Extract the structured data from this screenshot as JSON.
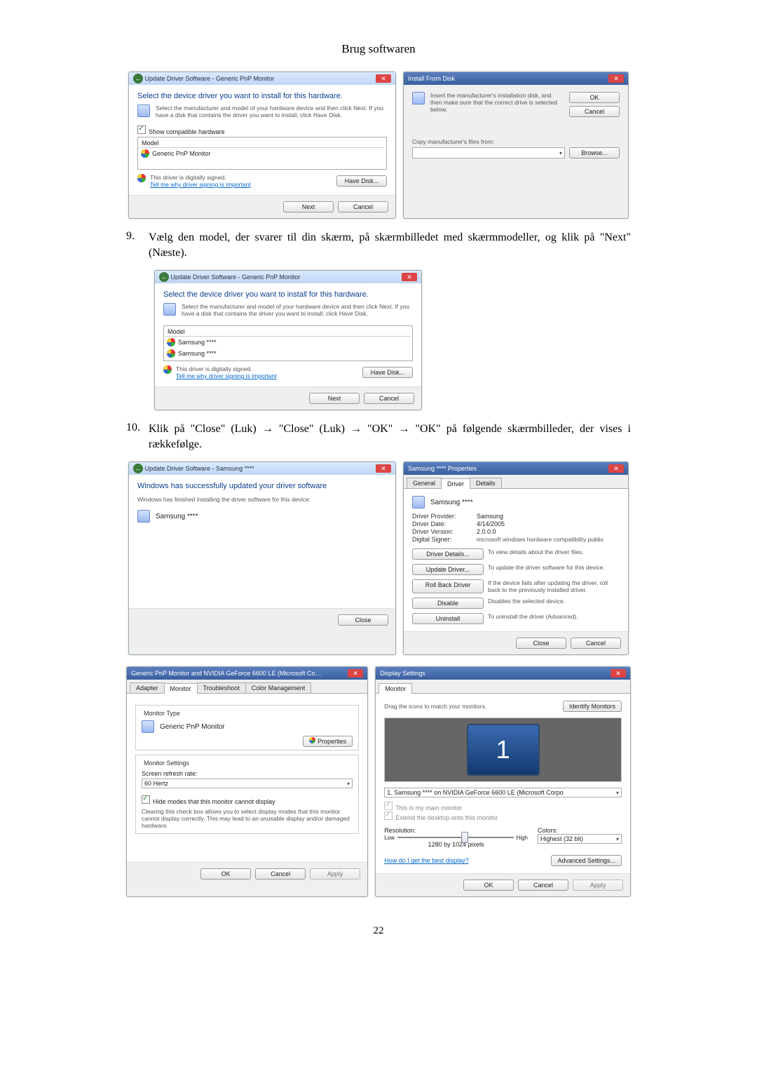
{
  "page": {
    "title": "Brug softwaren",
    "number": "22"
  },
  "steps": {
    "s9_num": "9.",
    "s9_text": "Vælg den model, der svarer til din skærm, på skærmbilledet med skærmmodeller, og klik på \"Next\" (Næste).",
    "s10_num": "10.",
    "s10_text": "Klik på \"Close\" (Luk) → \"Close\" (Luk) → \"OK\" → \"OK\" på følgende skærmbilleder, der vises i rækkefølge."
  },
  "wizard1": {
    "header": "Update Driver Software - Generic PnP Monitor",
    "heading": "Select the device driver you want to install for this hardware.",
    "desc": "Select the manufacturer and model of your hardware device and then click Next. If you have a disk that contains the driver you want to install, click Have Disk.",
    "show_compat": "Show compatible hardware",
    "model_lbl": "Model",
    "model1": "Generic PnP Monitor",
    "signed": "This driver is digitally signed.",
    "why": "Tell me why driver signing is important",
    "have_disk": "Have Disk...",
    "next": "Next",
    "cancel": "Cancel"
  },
  "install_from_disk": {
    "title": "Install From Disk",
    "msg": "Insert the manufacturer's installation disk, and then make sure that the correct drive is selected below.",
    "ok": "OK",
    "cancel": "Cancel",
    "copy_label": "Copy manufacturer's files from:",
    "drive": "",
    "browse": "Browse..."
  },
  "wizard2": {
    "header": "Update Driver Software - Generic PnP Monitor",
    "heading": "Select the device driver you want to install for this hardware.",
    "desc": "Select the manufacturer and model of your hardware device and then click Next. If you have a disk that contains the driver you want to install, click Have Disk.",
    "model_lbl": "Model",
    "model1": "Samsung ****",
    "model2": "Samsung ****",
    "signed": "This driver is digitally signed.",
    "why": "Tell me why driver signing is important",
    "have_disk": "Have Disk...",
    "next": "Next",
    "cancel": "Cancel"
  },
  "finish": {
    "header": "Update Driver Software - Samsung ****",
    "heading": "Windows has successfully updated your driver software",
    "desc": "Windows has finished installing the driver software for this device:",
    "device": "Samsung ****",
    "close": "Close"
  },
  "props": {
    "title": "Samsung **** Properties",
    "tab_general": "General",
    "tab_driver": "Driver",
    "tab_details": "Details",
    "device_name": "Samsung ****",
    "provider_lbl": "Driver Provider:",
    "provider_val": "Samsung",
    "date_lbl": "Driver Date:",
    "date_val": "4/14/2005",
    "version_lbl": "Driver Version:",
    "version_val": "2.0.0.0",
    "signer_lbl": "Digital Signer:",
    "signer_val": "microsoft windows hardware compatibility publis",
    "btn_details": "Driver Details...",
    "btn_details_desc": "To view details about the driver files.",
    "btn_update": "Update Driver...",
    "btn_update_desc": "To update the driver software for this device.",
    "btn_rollback": "Roll Back Driver",
    "btn_rollback_desc": "If the device fails after updating the driver, roll back to the previously installed driver.",
    "btn_disable": "Disable",
    "btn_disable_desc": "Disables the selected device.",
    "btn_uninstall": "Uninstall",
    "btn_uninstall_desc": "To uninstall the driver (Advanced).",
    "close": "Close",
    "cancel": "Cancel"
  },
  "monitor_tab": {
    "title": "Generic PnP Monitor and NVIDIA GeForce 6600 LE (Microsoft Co…",
    "tab_adapter": "Adapter",
    "tab_monitor": "Monitor",
    "tab_trouble": "Troubleshoot",
    "tab_color": "Color Management",
    "group_type": "Monitor Type",
    "type_val": "Generic PnP Monitor",
    "btn_properties": "Properties",
    "group_settings": "Monitor Settings",
    "refresh_lbl": "Screen refresh rate:",
    "refresh_val": "60 Hertz",
    "hide_chk": "Hide modes that this monitor cannot display",
    "hide_desc": "Clearing this check box allows you to select display modes that this monitor cannot display correctly. This may lead to an unusable display and/or damaged hardware.",
    "ok": "OK",
    "cancel": "Cancel",
    "apply": "Apply"
  },
  "display_settings": {
    "title": "Display Settings",
    "tab_monitor": "Monitor",
    "drag": "Drag the icons to match your monitors.",
    "identify": "Identify Monitors",
    "monitor_num": "1",
    "monitor_sel": "1. Samsung **** on NVIDIA GeForce 6600 LE (Microsoft Corpo",
    "main_chk": "This is my main monitor",
    "extend_chk": "Extend the desktop onto this monitor",
    "res_lbl": "Resolution:",
    "low": "Low",
    "high": "High",
    "res_val": "1280 by 1024 pixels",
    "colors_lbl": "Colors:",
    "colors_val": "Highest (32 bit)",
    "best_link": "How do I get the best display?",
    "adv": "Advanced Settings...",
    "ok": "OK",
    "cancel": "Cancel",
    "apply": "Apply"
  },
  "icons": {
    "close_x": "✕"
  }
}
